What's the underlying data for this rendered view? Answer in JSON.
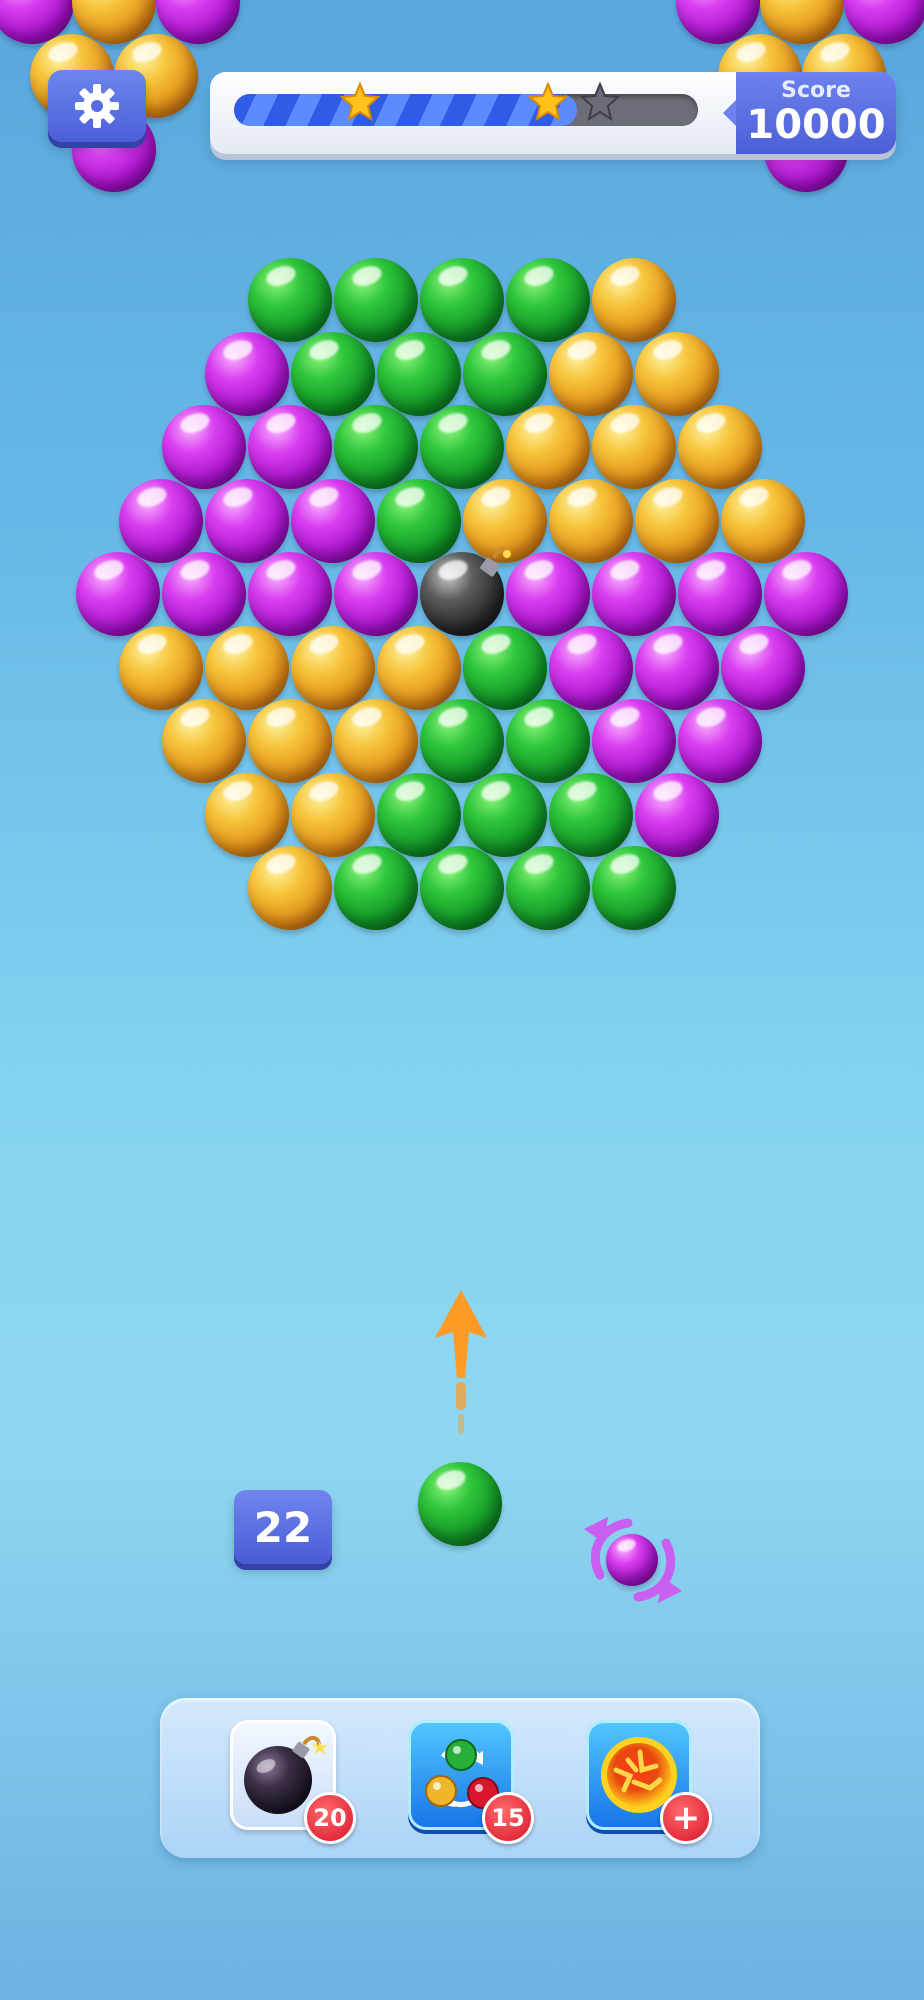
{
  "header": {
    "score_label": "Score",
    "score_value": "10000",
    "progress_fraction": 0.74,
    "stars": [
      {
        "name": "star-1",
        "earned": true
      },
      {
        "name": "star-2",
        "earned": true
      },
      {
        "name": "star-3",
        "earned": false
      }
    ],
    "settings_icon": "gear-icon"
  },
  "board": {
    "colors": {
      "green": "#2fc63b",
      "gold": "#f6c43a",
      "purple": "#d93ff0",
      "bomb": "#252525"
    },
    "rows": [
      [
        "green",
        "green",
        "green",
        "green",
        "gold"
      ],
      [
        "purple",
        "green",
        "green",
        "green",
        "gold",
        "gold"
      ],
      [
        "purple",
        "purple",
        "green",
        "green",
        "gold",
        "gold",
        "gold"
      ],
      [
        "purple",
        "purple",
        "purple",
        "green",
        "gold",
        "gold",
        "gold",
        "gold"
      ],
      [
        "purple",
        "purple",
        "purple",
        "purple",
        "bomb",
        "purple",
        "purple",
        "purple",
        "purple"
      ],
      [
        "gold",
        "gold",
        "gold",
        "gold",
        "green",
        "purple",
        "purple",
        "purple"
      ],
      [
        "gold",
        "gold",
        "gold",
        "green",
        "green",
        "purple",
        "purple"
      ],
      [
        "gold",
        "gold",
        "green",
        "green",
        "green",
        "purple"
      ],
      [
        "gold",
        "green",
        "green",
        "green",
        "green"
      ]
    ]
  },
  "shooter": {
    "current_bubble": "green",
    "next_bubble": "purple",
    "moves_left": "22",
    "swap_icon": "swap-arrows-icon"
  },
  "boosters": [
    {
      "name": "bomb-booster",
      "icon": "bomb-icon",
      "count": "20"
    },
    {
      "name": "color-swap-booster",
      "icon": "color-swap-icon",
      "count": "15"
    },
    {
      "name": "fireball-booster",
      "icon": "fireball-icon",
      "count": "+"
    }
  ]
}
